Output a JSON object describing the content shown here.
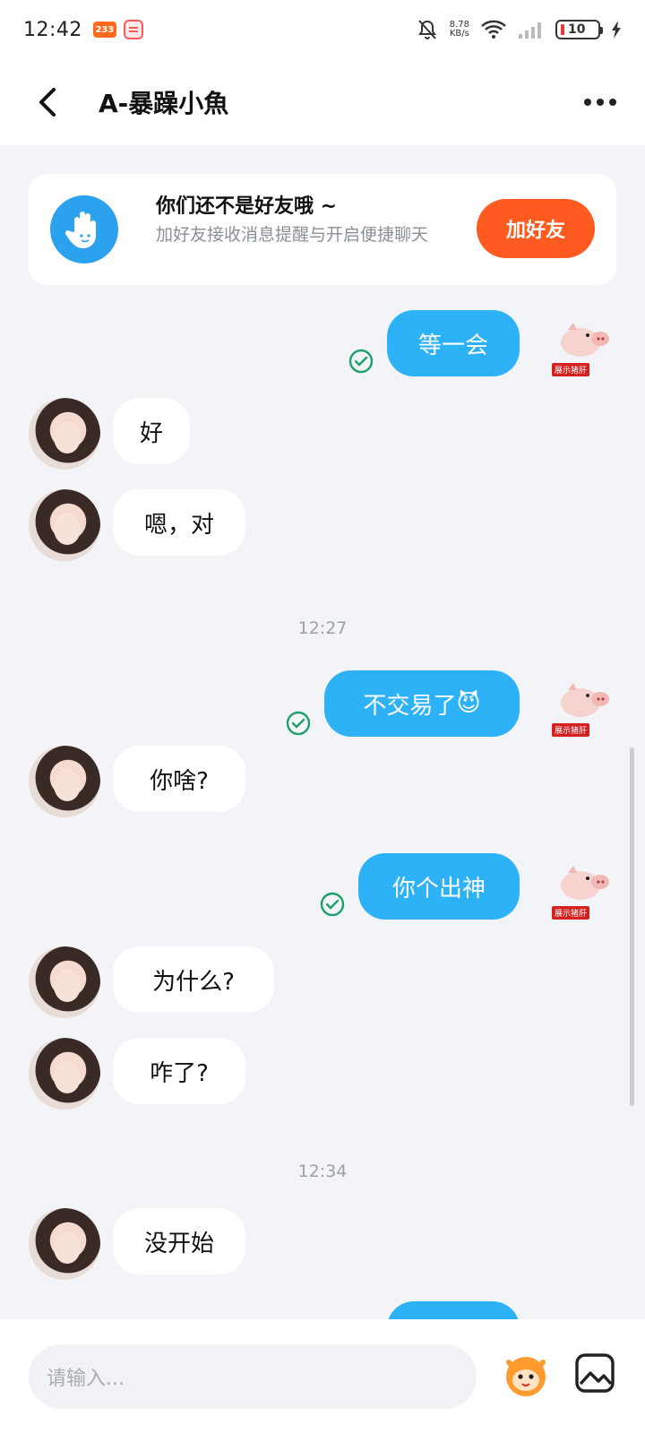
{
  "status_bar": {
    "time": "12:42",
    "notif_badge": "233",
    "speed_value": "8.78",
    "speed_unit": "KB/s",
    "battery": "10"
  },
  "header": {
    "title": "A-暴躁小魚"
  },
  "friend_card": {
    "title": "你们还不是好友哦 ~",
    "subtitle": "加好友接收消息提醒与开启便捷聊天",
    "button": "加好友"
  },
  "messages": [
    {
      "dir": "out",
      "text": "等一会"
    },
    {
      "dir": "in",
      "text": "好"
    },
    {
      "dir": "in",
      "text": "嗯，对"
    },
    {
      "dir": "time",
      "text": "12:27"
    },
    {
      "dir": "out",
      "text": "不交易了",
      "emoji": "😈"
    },
    {
      "dir": "in",
      "text": "你啥?"
    },
    {
      "dir": "out",
      "text": "你个出神"
    },
    {
      "dir": "in",
      "text": "为什么?"
    },
    {
      "dir": "in",
      "text": "咋了?"
    },
    {
      "dir": "time",
      "text": "12:34"
    },
    {
      "dir": "in",
      "text": "没开始"
    }
  ],
  "sticker_label": "展示猪肝",
  "input": {
    "placeholder": "请输入..."
  },
  "colors": {
    "accent_blue": "#2db2f8",
    "add_friend_orange": "#ff5a1f",
    "background": "#f3f4f8"
  }
}
